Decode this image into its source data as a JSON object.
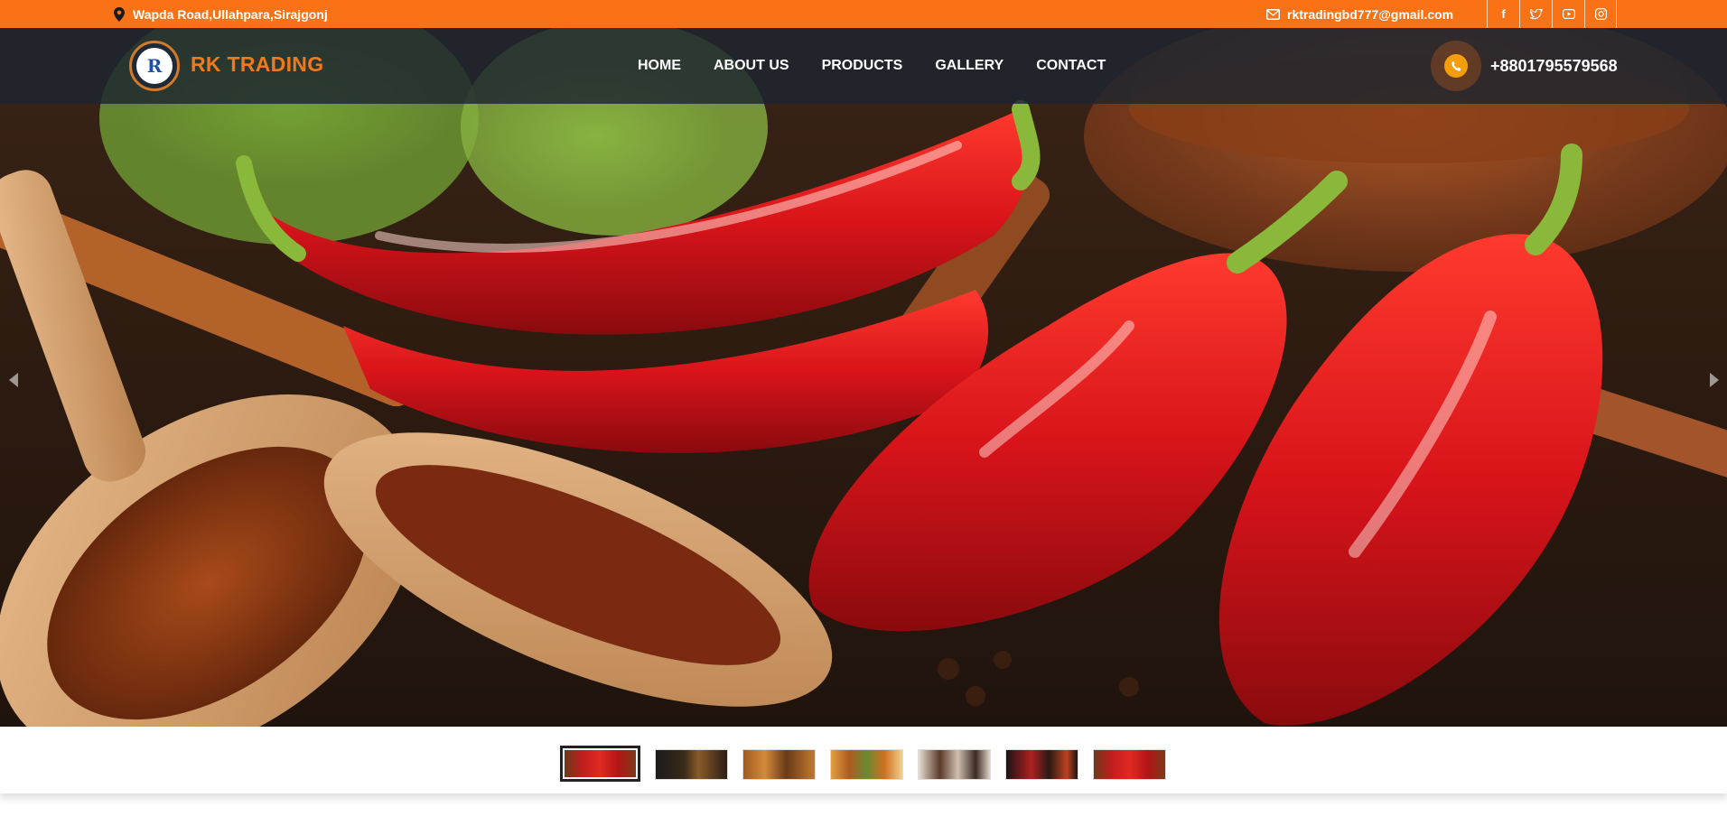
{
  "topbar": {
    "address": "Wapda Road,Ullahpara,Sirajgonj",
    "email": "rktradingbd777@gmail.com",
    "socials": [
      {
        "name": "facebook-icon",
        "glyph": "f"
      },
      {
        "name": "twitter-icon",
        "glyph": "t"
      },
      {
        "name": "youtube-icon",
        "glyph": "▶"
      },
      {
        "name": "instagram-icon",
        "glyph": "◎"
      }
    ],
    "accent": "#f97316"
  },
  "header": {
    "brand": "RK TRADING",
    "logo_letter": "R",
    "nav": [
      "HOME",
      "ABOUT US",
      "PRODUCTS",
      "GALLERY",
      "CONTACT"
    ],
    "phone": "+8801795579568",
    "phone_icon": "phone-icon"
  },
  "hero": {
    "slide_count": 7,
    "active_slide": 1,
    "controls": {
      "prev": "prev-arrow-icon",
      "next": "next-arrow-icon"
    }
  }
}
